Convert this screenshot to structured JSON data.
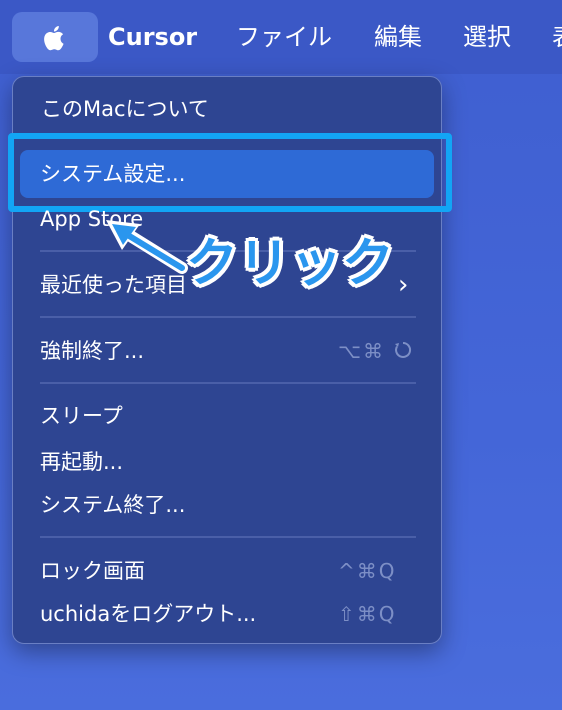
{
  "menubar": {
    "app_name": "Cursor",
    "items": [
      "ファイル",
      "編集",
      "選択",
      "表"
    ]
  },
  "apple_menu": {
    "about": "このMacについて",
    "system_settings": "システム設定...",
    "app_store": "App Store",
    "recent_items": "最近使った項目",
    "force_quit": "強制終了...",
    "force_quit_shortcut": "⌥⌘",
    "sleep": "スリープ",
    "restart": "再起動...",
    "shutdown": "システム終了...",
    "lock_screen": "ロック画面",
    "lock_screen_shortcut": "^⌘Q",
    "logout": "uchidaをログアウト...",
    "logout_shortcut": "⇧⌘Q"
  },
  "annotation": {
    "callout_text": "クリック",
    "frame_color": "#12a5f5"
  },
  "icons": {
    "apple": "apple-logo-icon",
    "chevron": "chevron-right-icon",
    "power": "power-icon"
  }
}
